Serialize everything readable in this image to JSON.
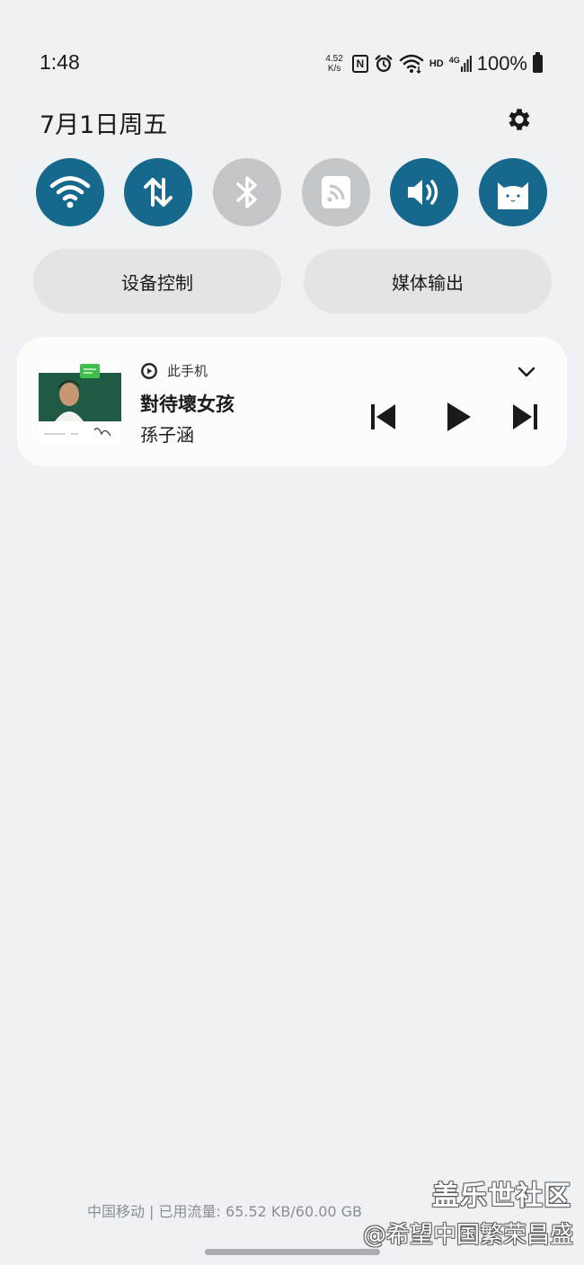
{
  "status_bar": {
    "time": "1:48",
    "net_speed_value": "4.52",
    "net_speed_unit": "K/s",
    "nfc_label": "N",
    "hd_label": "HD",
    "network_type": "4G",
    "battery_percent": "100%"
  },
  "header": {
    "date": "7月1日周五"
  },
  "quick_toggles": [
    {
      "name": "wifi-icon",
      "state": "on"
    },
    {
      "name": "mobile-data-icon",
      "state": "on"
    },
    {
      "name": "bluetooth-icon",
      "state": "off"
    },
    {
      "name": "nfc-icon",
      "state": "off"
    },
    {
      "name": "sound-icon",
      "state": "on"
    },
    {
      "name": "cat-icon",
      "state": "on"
    }
  ],
  "buttons": {
    "device_control": "设备控制",
    "media_output": "媒体输出"
  },
  "media": {
    "device": "此手机",
    "title": "對待壞女孩",
    "artist": "孫子涵"
  },
  "footer": {
    "carrier_usage": "中国移动 | 已用流量: 65.52 KB/60.00 GB",
    "watermark_line1": "盖乐世社区",
    "watermark_line2": "@希望中国繁荣昌盛"
  },
  "colors": {
    "toggle_on": "#16688d",
    "toggle_off": "#c4c7ca",
    "background": "#eef2f5"
  }
}
